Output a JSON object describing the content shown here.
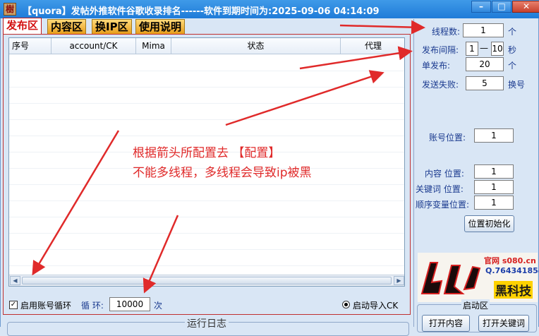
{
  "window": {
    "title": "【quora】发帖外推软件谷歌收录排名------软件到期时间为:2025-09-06 04:14:09",
    "icon_glyph": "樹",
    "minimize": "–",
    "maximize": "□",
    "close": "✕"
  },
  "tabs": [
    "发布区",
    "内容区",
    "换IP区",
    "使用说明"
  ],
  "table": {
    "columns": [
      "序号",
      "account/CK",
      "Mima",
      "状态",
      "代理"
    ]
  },
  "options": {
    "loop_label": "启用账号循环",
    "loop_checked": true,
    "cycle_label": "循 环:",
    "cycle_value": "10000",
    "cycle_unit": "次",
    "auto_import_label": "启动导入CK"
  },
  "settings": {
    "threads_label": "线程数:",
    "threads_value": "1",
    "threads_unit": "个",
    "interval_label": "发布间隔:",
    "interval_min": "1",
    "interval_sep": "—",
    "interval_max": "10",
    "interval_unit": "秒",
    "single_label": "单发布:",
    "single_value": "20",
    "single_unit": "个",
    "fail_label": "发送失败:",
    "fail_value": "5",
    "fail_unit": "换号",
    "account_pos_label": "账号位置:",
    "account_pos_value": "1",
    "content_pos_label": "内容 位置:",
    "content_pos_value": "1",
    "keyword_pos_label": "关键词 位置:",
    "keyword_pos_value": "1",
    "seqvar_pos_label": "顺序变量位置:",
    "seqvar_pos_value": "1",
    "reset_button": "位置初始化"
  },
  "logo": {
    "site": "官网 s080.cn",
    "qq": "Q.764341854",
    "brand": "黑科技"
  },
  "start_area": {
    "label": "启动区",
    "open_content": "打开内容",
    "open_keywords": "打开关键词"
  },
  "log": {
    "title": "运行日志"
  },
  "annotation": {
    "line1": "根据箭头所配置去  【配置】",
    "line2": "不能多线程，多线程会导致ip被黑"
  },
  "colors": {
    "accent_red": "#e02a2a",
    "titlebar_blue": "#2a88e0",
    "tab_orange": "#f0a830"
  }
}
